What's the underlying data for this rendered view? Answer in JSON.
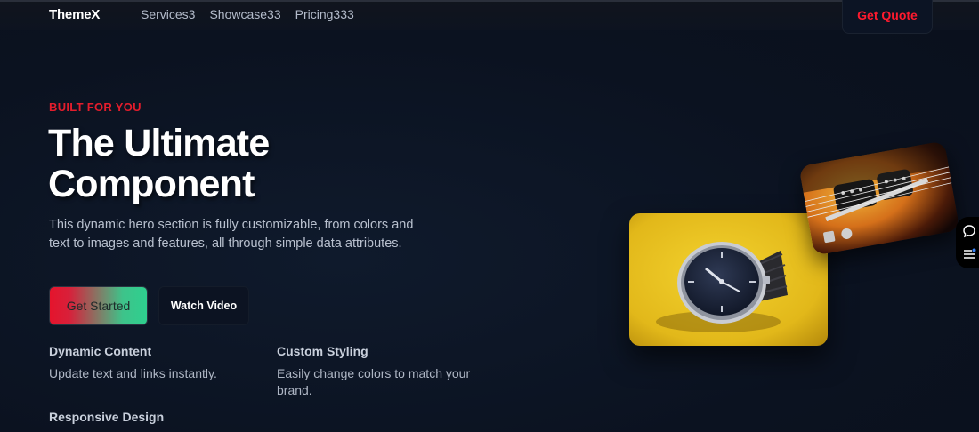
{
  "nav": {
    "logo": "ThemeX",
    "links": [
      "Services3",
      "Showcase33",
      "Pricing333"
    ],
    "cta": "Get Quote"
  },
  "hero": {
    "eyebrow": "BUILT FOR YOU",
    "title_line1": "The Ultimate",
    "title_line2": "Component",
    "description": "This dynamic hero section is fully customizable, from colors and text to images and features, all through simple data attributes.",
    "primary_button": "Get Started",
    "secondary_button": "Watch Video"
  },
  "features": [
    {
      "title": "Dynamic Content",
      "text": "Update text and links instantly."
    },
    {
      "title": "Custom Styling",
      "text": "Easily change colors to match your brand."
    },
    {
      "title": "Responsive Design",
      "text": ""
    }
  ],
  "images": {
    "watch_icon": "wristwatch-image",
    "guitar_icon": "guitar-image"
  },
  "side_widget": {
    "icons": [
      "chat-icon",
      "menu-list-icon"
    ]
  },
  "colors": {
    "accent": "#e41d2c",
    "background": "#0b1220",
    "gradient_end": "#2ed08f"
  }
}
